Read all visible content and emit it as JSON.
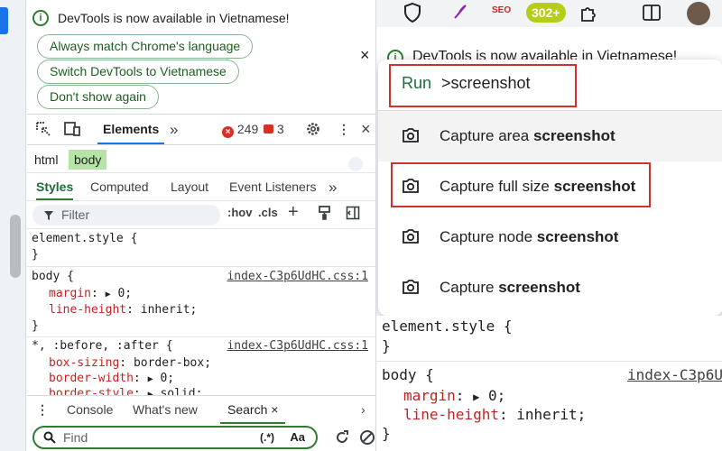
{
  "left": {
    "banner": {
      "message": "DevTools is now available in Vietnamese!",
      "buttons": [
        "Always match Chrome's language",
        "Switch DevTools to Vietnamese",
        "Don't show again"
      ],
      "close": "×"
    },
    "toolbar": {
      "elements_tab": "Elements",
      "more": "»",
      "error_count": "249",
      "warning_count": "3"
    },
    "breadcrumb": [
      "html",
      "body"
    ],
    "styles_tabs": [
      "Styles",
      "Computed",
      "Layout",
      "Event Listeners"
    ],
    "styles_more": "»",
    "filter": {
      "placeholder": "Filter",
      "hov": ":hov",
      "cls": ".cls",
      "plus": "+"
    },
    "rules": {
      "element_style": {
        "selector": "element.style {",
        "close": "}"
      },
      "body": {
        "selector": "body {",
        "source": "index-C3p6UdHC.css:1",
        "props": [
          {
            "name": "margin",
            "value": "0;"
          },
          {
            "name": "line-height",
            "value": "inherit;"
          }
        ],
        "close": "}"
      },
      "universal": {
        "selector": "*, :before, :after {",
        "source": "index-C3p6UdHC.css:1",
        "props": [
          {
            "name": "box-sizing",
            "value": "border-box;"
          },
          {
            "name": "border-width",
            "value": "0;"
          },
          {
            "name": "border-style",
            "value": "solid;"
          }
        ]
      }
    },
    "drawer": {
      "tabs": [
        "Console",
        "What's new",
        "Search"
      ],
      "close": "×"
    },
    "search": {
      "placeholder": "Find",
      "regex": "(.*)",
      "case": "Aa"
    }
  },
  "right": {
    "extension_badge": "302+",
    "banner_text": "DevTools is now available in Vietnamese!",
    "command_menu": {
      "prefix": "Run",
      "query": ">screenshot",
      "items": [
        {
          "normal": "Capture area ",
          "bold": "screenshot"
        },
        {
          "normal": "Capture full size ",
          "bold": "screenshot"
        },
        {
          "normal": "Capture node ",
          "bold": "screenshot"
        },
        {
          "normal": "Capture ",
          "bold": "screenshot"
        }
      ]
    },
    "code": {
      "element_style": "element.style {",
      "close1": "}",
      "body_selector": "body {",
      "source": "index-C3p6U",
      "props": [
        {
          "name": "margin",
          "value": "0;"
        },
        {
          "name": "line-height",
          "value": "inherit;"
        }
      ]
    }
  },
  "colors": {
    "accent_green": "#2e7d32",
    "highlight_red": "#d32f2f",
    "badge_green": "#b5cc18"
  }
}
